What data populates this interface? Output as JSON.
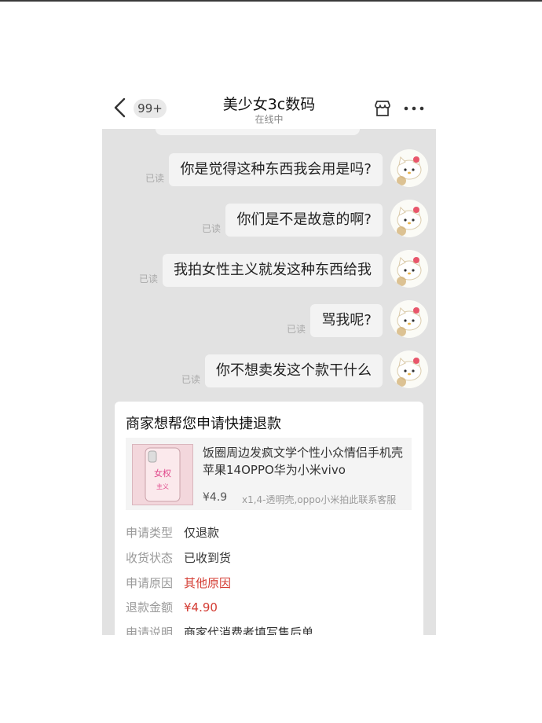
{
  "header": {
    "unread_badge": "99+",
    "title": "美少女3c数码",
    "status": "在线中"
  },
  "messages": [
    {
      "text": "你是觉得这种东西我会用是吗?",
      "read": "已读"
    },
    {
      "text": "你们是不是故意的啊?",
      "read": "已读"
    },
    {
      "text": "我拍女性主义就发这种东西给我",
      "read": "已读"
    },
    {
      "text": "骂我呢?",
      "read": "已读"
    },
    {
      "text": "你不想卖发这个款干什么",
      "read": "已读"
    }
  ],
  "refund_card": {
    "title": "商家想帮您申请快捷退款",
    "product": {
      "name": "饭圈周边发疯文学个性小众情侣手机壳苹果14OPPO华为小米vivo",
      "price": "¥4.9",
      "sku": "x1,4-透明壳,oppo小米拍此联系客服",
      "thumb_text": [
        "女权",
        "主义"
      ]
    },
    "rows": [
      {
        "label": "申请类型",
        "value": "仅退款"
      },
      {
        "label": "收货状态",
        "value": "已收到货"
      },
      {
        "label": "申请原因",
        "value": "其他原因"
      },
      {
        "label": "退款金额",
        "value": "¥4.90"
      },
      {
        "label": "申请说明",
        "value": "商家代消费者填写售后单"
      }
    ]
  },
  "colors": {
    "chat_bg": "#e2e2e2",
    "bubble_bg": "#f3f3f3",
    "accent_red": "#d43c33"
  },
  "icons": [
    "back-chevron-icon",
    "store-icon",
    "more-icon"
  ]
}
